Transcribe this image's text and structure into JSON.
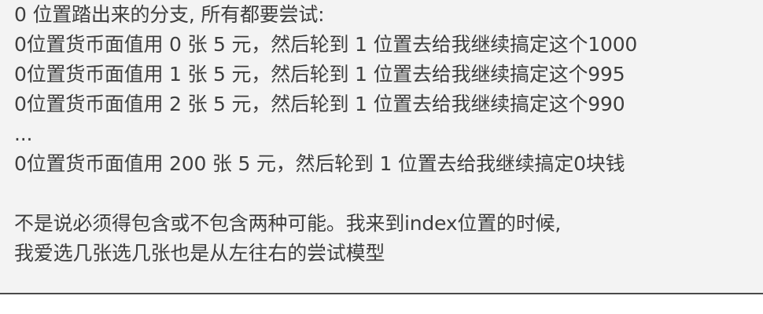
{
  "note": {
    "lines": [
      "0 位置踏出来的分支, 所有都要尝试:",
      "0位置货币面值用 0 张 5 元，然后轮到 1 位置去给我继续搞定这个1000",
      "0位置货币面值用 1 张 5 元，然后轮到 1 位置去给我继续搞定这个995",
      "0位置货币面值用 2 张 5 元，然后轮到 1 位置去给我继续搞定这个990",
      "...",
      "0位置货币面值用 200 张 5 元，然后轮到 1 位置去给我继续搞定0块钱",
      "不是说必须得包含或不包含两种可能。我来到index位置的时候,",
      "我爱选几张选几张也是从左往右的尝试模型"
    ]
  }
}
